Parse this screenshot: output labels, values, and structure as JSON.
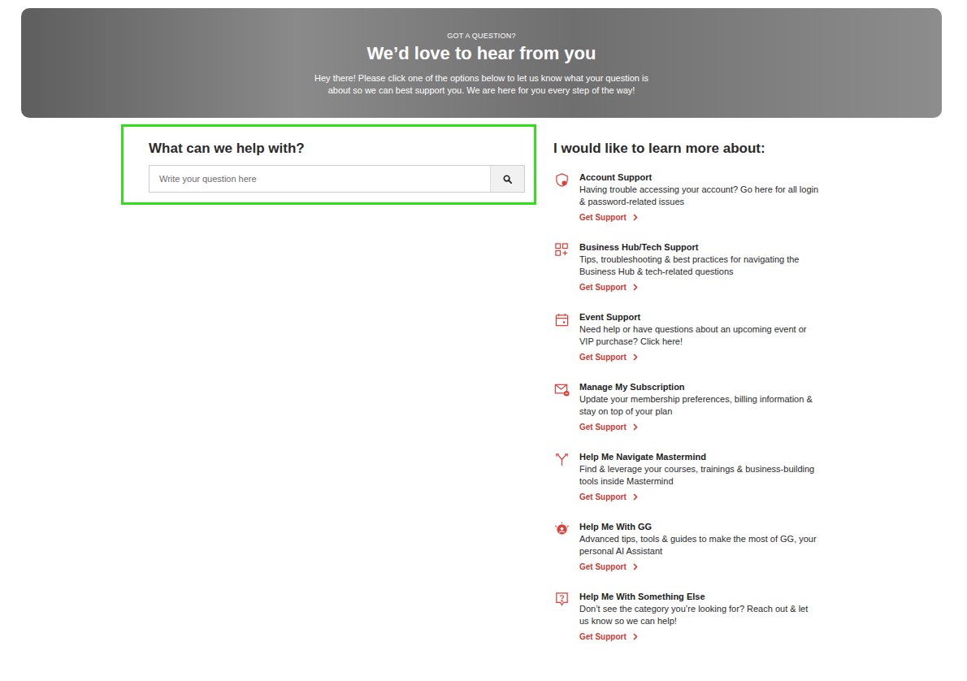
{
  "hero": {
    "eyebrow": "GOT A QUESTION?",
    "title": "We’d love to hear from you",
    "text": "Hey there! Please click one of the options below to let us know what your question is about so we can best support you. We are here for you every step of the way!"
  },
  "search": {
    "heading": "What can we help with?",
    "placeholder": "Write your question here",
    "highlighted": true
  },
  "topics": {
    "heading": "I would like to learn more about:",
    "items": [
      {
        "title": "Account Support",
        "description": "Having trouble accessing your account? Go here for all login & password-related issues",
        "link": "Get Support"
      },
      {
        "title": "Business Hub/Tech Support",
        "description": "Tips, troubleshooting & best practices for navigating the Business Hub & tech-related questions",
        "link": "Get Support"
      },
      {
        "title": "Event Support",
        "description": "Need help or have questions about an upcoming event or VIP purchase? Click here!",
        "link": "Get Support"
      },
      {
        "title": "Manage My Subscription",
        "description": "Update your membership preferences, billing information & stay on top of your plan",
        "link": "Get Support"
      },
      {
        "title": "Help Me Navigate Mastermind",
        "description": "Find & leverage your courses, trainings & business-building tools inside Mastermind",
        "link": "Get Support"
      },
      {
        "title": "Help Me With GG",
        "description": "Advanced tips, tools & guides to make the most of GG, your personal AI Assistant",
        "link": "Get Support"
      },
      {
        "title": "Help Me With Something Else",
        "description": "Don’t see the category you’re looking for? Reach out & let us know so we can help!",
        "link": "Get Support"
      }
    ]
  }
}
